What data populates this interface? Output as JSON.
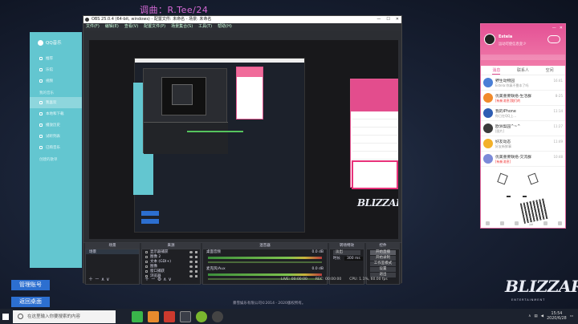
{
  "overlay": {
    "text": "调曲：R.Tee/24"
  },
  "qq_music": {
    "title": "QQ音乐",
    "items": [
      {
        "label": "推荐",
        "active": false
      },
      {
        "label": "乐馆",
        "active": false
      },
      {
        "label": "视频",
        "active": false
      },
      {
        "label": "我喜欢",
        "active": true
      },
      {
        "label": "本地和下载",
        "active": false
      },
      {
        "label": "播放历史",
        "active": false
      },
      {
        "label": "试听列表",
        "active": false
      },
      {
        "label": "已购音乐",
        "active": false
      }
    ],
    "section": "创建的歌单"
  },
  "side_buttons": {
    "manage": "管理账号",
    "return_desktop": "返回桌面"
  },
  "obs": {
    "title": "OBS 25.0.4 (64-bit, windows) - 配置文件: 未命名 - 场景: 未命名",
    "menu": [
      "文件(F)",
      "编辑(E)",
      "查看(V)",
      "配置文件(P)",
      "场景集合(S)",
      "工具(T)",
      "帮助(H)"
    ],
    "window_controls": [
      "—",
      "☐",
      "✕"
    ],
    "dock_headers": {
      "scenes": "场景",
      "sources": "来源",
      "mixer": "混音器",
      "transitions": "转场特效",
      "controls": "控件"
    },
    "scene_name": "场景",
    "sources": [
      "显示器捕获",
      "图像 2",
      "文本 (GDI+)",
      "图像",
      "窗口捕获",
      "浏览器"
    ],
    "mixer": [
      {
        "name": "桌面音频",
        "level": "0.0 dB"
      },
      {
        "name": "麦克风/Aux",
        "level": "0.0 dB"
      }
    ],
    "transition": {
      "type": "淡出",
      "duration_label": "时长",
      "duration": "300 ms"
    },
    "controls": [
      "开始直播",
      "开始录制",
      "工作室模式",
      "设置",
      "退出"
    ],
    "status": {
      "live": "LIVE: 00:00:00",
      "rec": "REC: 00:00:00",
      "cpu": "CPU: 1.1%, 60.00 fps"
    }
  },
  "footer": {
    "copyright": "暴雪娱乐有限公司©2014 - 2020版权所有。"
  },
  "qq_chat": {
    "user": {
      "nickname": "Estela",
      "status_line": "运动可使信息变少"
    },
    "tabs": [
      "消息",
      "联系人",
      "空间"
    ],
    "active_tab": 0,
    "chats": [
      {
        "name": "野生动物园",
        "preview": "Estela:你真不靠本了吗",
        "time": "16:41",
        "color": "#4a7fd6",
        "red": false
      },
      {
        "name": "优美重要联络-生活群",
        "preview": "[有新消息]我们的",
        "time": "8-25",
        "color": "#f18a2b",
        "red": true
      },
      {
        "name": "我的iPhone",
        "preview": "你已在QQ上...",
        "time": "11:14",
        "color": "#2e5db3",
        "red": false
      },
      {
        "name": "欧洲梨园^~^",
        "preview": "[图片]",
        "time": "11:27",
        "color": "#3a3a3a",
        "red": false
      },
      {
        "name": "好友动态",
        "preview": "好友新鲜事",
        "time": "11:49",
        "color": "#f3b12a",
        "red": false
      },
      {
        "name": "优美重要联络-交流群",
        "preview": "[有新消息]",
        "time": "10:48",
        "color": "#7b8ad8",
        "red": true
      }
    ]
  },
  "brand": {
    "name": "BLIZZARD",
    "sub": "ENTERTAINMENT"
  },
  "taskbar": {
    "search_placeholder": "在这里输入你要搜索的内容",
    "time": "15:54",
    "date": "2020/6/28"
  }
}
